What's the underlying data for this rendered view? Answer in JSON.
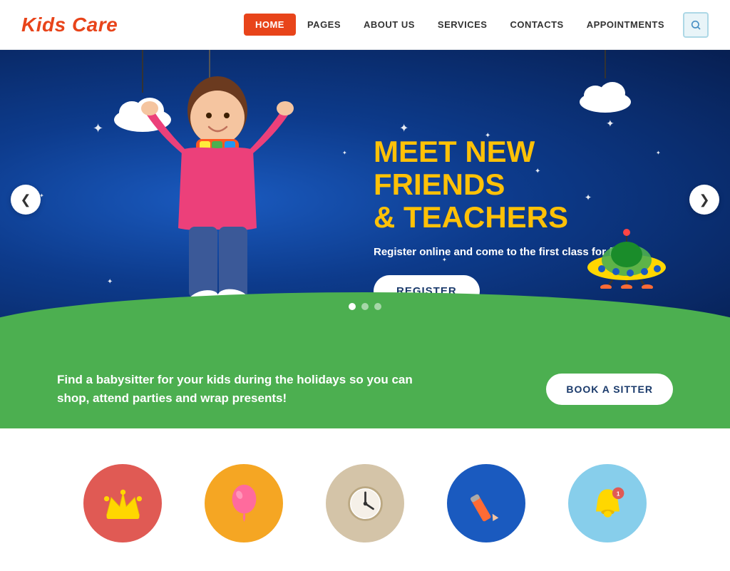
{
  "header": {
    "logo": "Kids Care",
    "nav_items": [
      {
        "label": "HOME",
        "active": true
      },
      {
        "label": "PAGES",
        "active": false
      },
      {
        "label": "ABOUT US",
        "active": false
      },
      {
        "label": "SERVICES",
        "active": false
      },
      {
        "label": "CONTACTS",
        "active": false
      },
      {
        "label": "APPOINTMENTS",
        "active": false
      }
    ],
    "search_label": "Search"
  },
  "hero": {
    "title_line1": "MEET NEW FRIENDS",
    "title_line2": "& TEACHERS",
    "subtitle": "Register online and come to the first class for free!",
    "btn_label": "REGISTER",
    "prev_arrow": "❮",
    "next_arrow": "❯",
    "dots": [
      {
        "active": true
      },
      {
        "active": false
      },
      {
        "active": false
      }
    ]
  },
  "green_banner": {
    "text": "Find a babysitter for your kids during the holidays so you can shop, attend parties and wrap presents!",
    "btn_label": "BOOK A SITTER"
  },
  "icons": [
    {
      "color": "#e05a54",
      "label": "crown"
    },
    {
      "color": "#f5a623",
      "label": "balloon"
    },
    {
      "color": "#d4c4a8",
      "label": "clock"
    },
    {
      "color": "#1a5abf",
      "label": "pencil"
    },
    {
      "color": "#87ceeb",
      "label": "bell"
    }
  ],
  "colors": {
    "primary_red": "#e8441a",
    "hero_bg": "#0d3b8c",
    "green": "#4caf50",
    "yellow": "#ffc107"
  }
}
